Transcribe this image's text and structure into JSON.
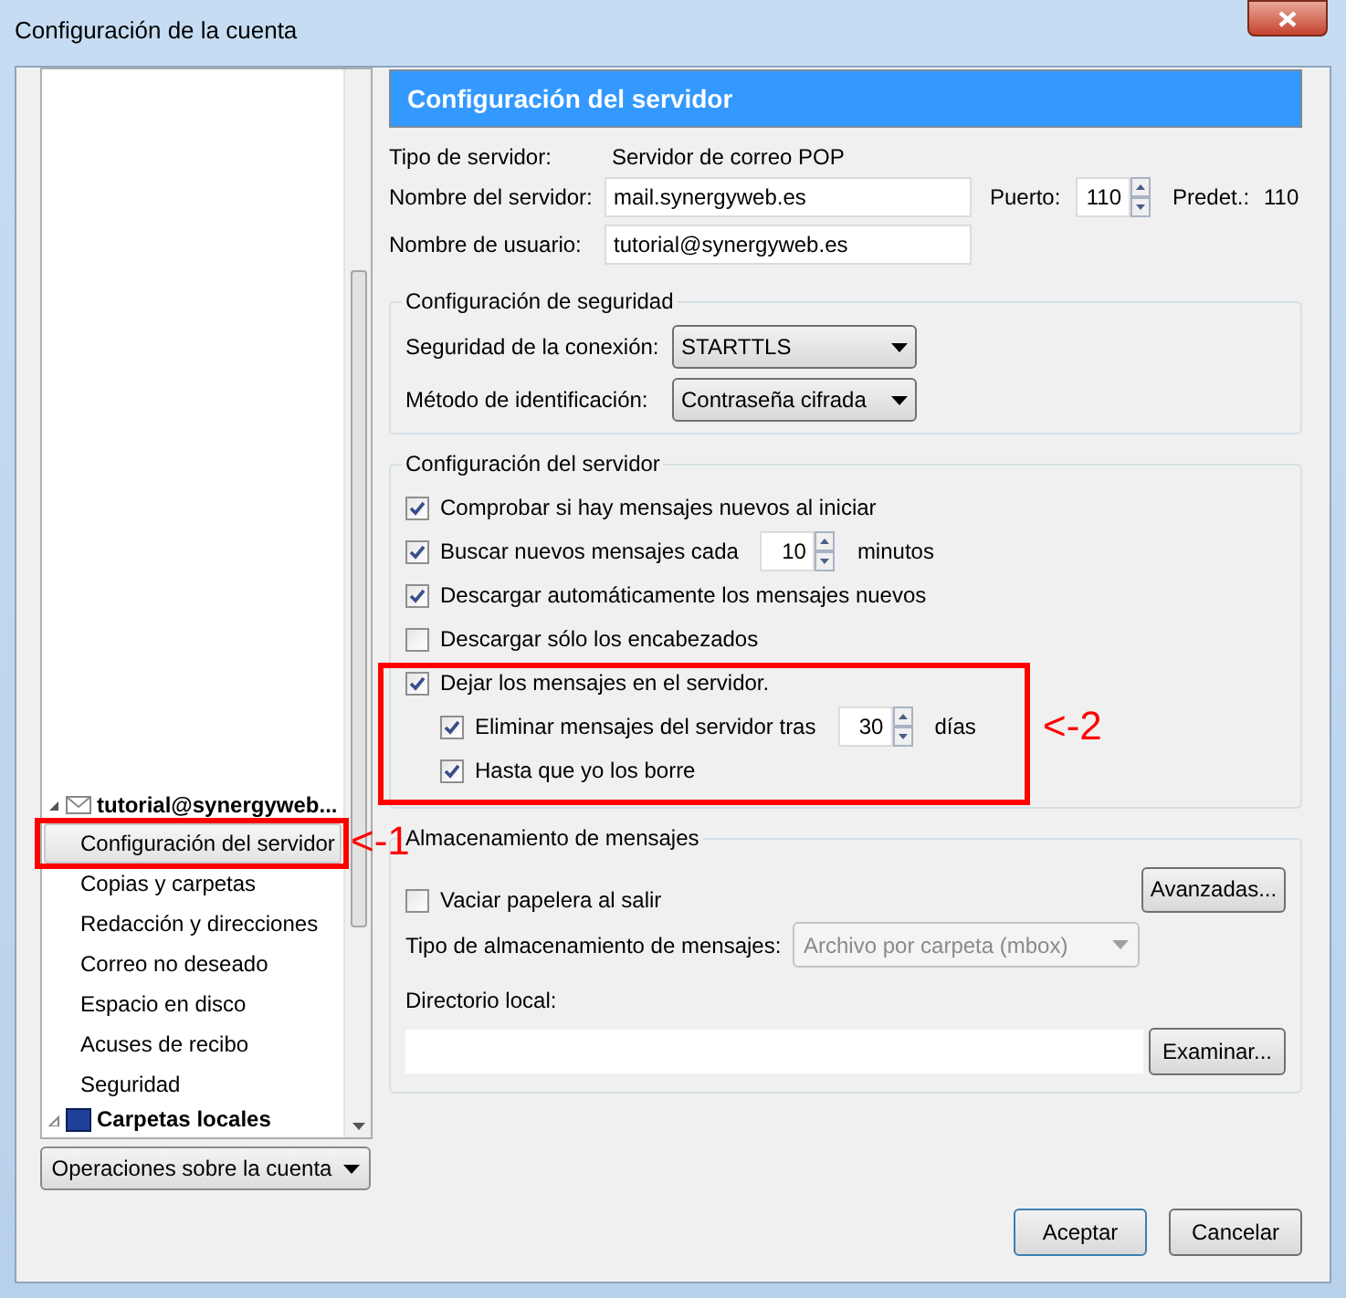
{
  "window": {
    "title": "Configuración de la cuenta"
  },
  "sidebar": {
    "account": {
      "label": "tutorial@synergyweb...",
      "expanded": true
    },
    "items": [
      {
        "label": "Configuración del servidor",
        "selected": true
      },
      {
        "label": "Copias y carpetas",
        "selected": false
      },
      {
        "label": "Redacción y direcciones",
        "selected": false
      },
      {
        "label": "Correo no deseado",
        "selected": false
      },
      {
        "label": "Espacio en disco",
        "selected": false
      },
      {
        "label": "Acuses de recibo",
        "selected": false
      },
      {
        "label": "Seguridad",
        "selected": false
      }
    ],
    "local_folders": {
      "label": "Carpetas locales",
      "expanded": false
    },
    "account_actions": "Operaciones sobre la cuenta"
  },
  "header": "Configuración del servidor",
  "server_type": {
    "label": "Tipo de servidor:",
    "value": "Servidor de correo POP"
  },
  "server_name": {
    "label": "Nombre del servidor:",
    "value": "mail.synergyweb.es"
  },
  "port": {
    "label": "Puerto:",
    "value": "110",
    "default_label": "Predet.:",
    "default_value": "110"
  },
  "user_name": {
    "label": "Nombre de usuario:",
    "value": "tutorial@synergyweb.es"
  },
  "security": {
    "title": "Configuración de seguridad",
    "connection": {
      "label": "Seguridad de la conexión:",
      "value": "STARTTLS"
    },
    "auth": {
      "label": "Método de identificación:",
      "value": "Contraseña cifrada"
    }
  },
  "server_settings": {
    "title": "Configuración del servidor",
    "options": [
      {
        "kind": "check",
        "label": "Comprobar si hay mensajes nuevos al iniciar",
        "checked": true
      },
      {
        "kind": "interval",
        "label": "Buscar nuevos mensajes cada",
        "value": "10",
        "unit": "minutos",
        "checked": true
      },
      {
        "kind": "check",
        "label": "Descargar automáticamente los mensajes nuevos",
        "checked": true
      },
      {
        "kind": "check",
        "label": "Descargar sólo los encabezados",
        "checked": false
      },
      {
        "kind": "check",
        "label": "Dejar los mensajes en el servidor.",
        "checked": true,
        "children": [
          {
            "kind": "interval",
            "label": "Eliminar mensajes del servidor tras",
            "value": "30",
            "unit": "días",
            "checked": true
          },
          {
            "kind": "check",
            "label": "Hasta que yo los borre",
            "checked": true
          }
        ]
      }
    ]
  },
  "storage": {
    "title": "Almacenamiento de mensajes",
    "advanced_button": "Avanzadas...",
    "empty_trash": {
      "label": "Vaciar papelera al salir",
      "checked": false
    },
    "store_type": {
      "label": "Tipo de almacenamiento de mensajes:",
      "value": "Archivo por carpeta (mbox)",
      "disabled": true
    },
    "local_dir": {
      "label": "Directorio local:"
    },
    "browse_button": "Examinar..."
  },
  "annotations": [
    {
      "label": "<-1"
    },
    {
      "label": "<-2"
    }
  ],
  "buttons": [
    "Aceptar",
    "Cancelar"
  ]
}
